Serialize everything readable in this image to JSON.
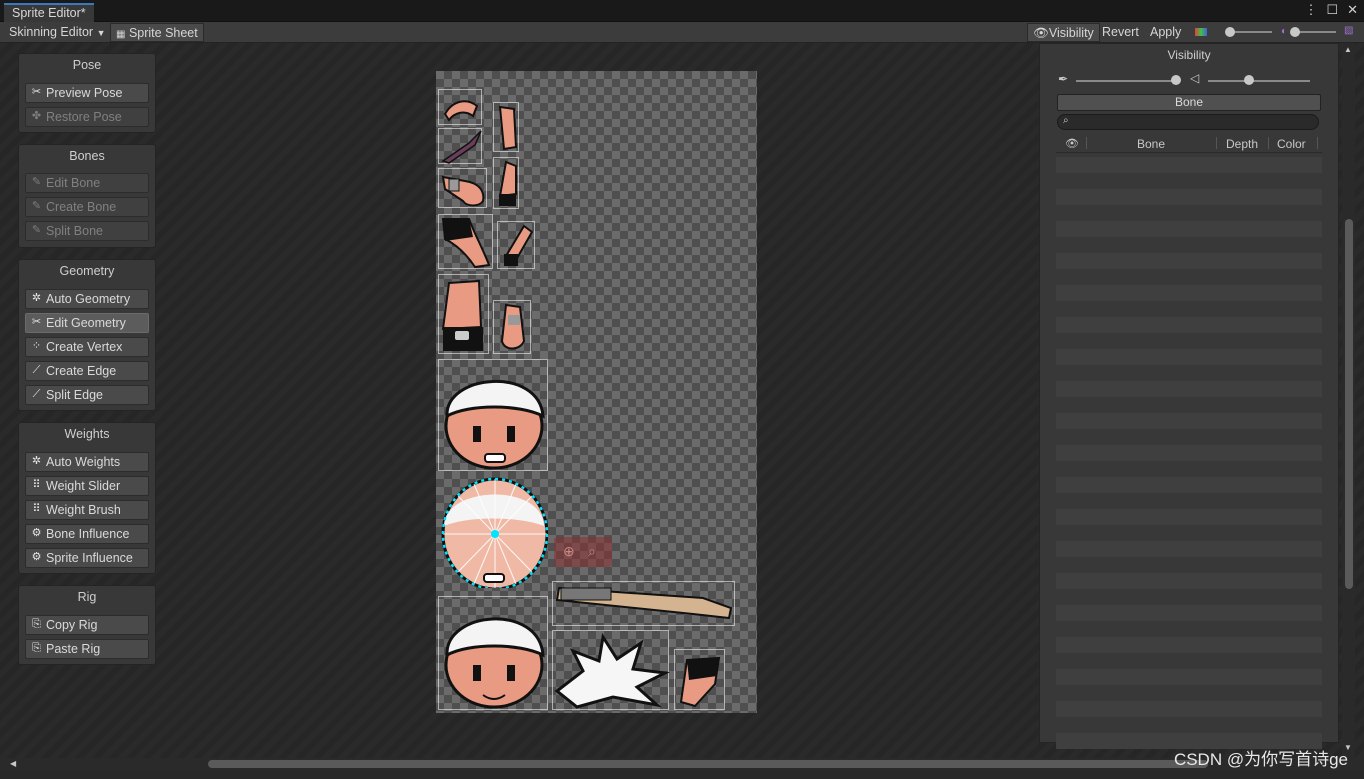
{
  "window": {
    "tab_title": "Sprite Editor*"
  },
  "toolbar": {
    "mode_dropdown": "Skinning Editor",
    "sprite_sheet": "Sprite Sheet",
    "visibility": "Visibility",
    "revert": "Revert",
    "apply": "Apply"
  },
  "pose": {
    "title": "Pose",
    "buttons": [
      "Preview Pose",
      "Restore Pose"
    ]
  },
  "bones": {
    "title": "Bones",
    "buttons": [
      "Edit Bone",
      "Create Bone",
      "Split Bone"
    ]
  },
  "geometry": {
    "title": "Geometry",
    "buttons": [
      "Auto Geometry",
      "Edit Geometry",
      "Create Vertex",
      "Create Edge",
      "Split Edge"
    ]
  },
  "weights": {
    "title": "Weights",
    "buttons": [
      "Auto Weights",
      "Weight Slider",
      "Weight Brush",
      "Bone Influence",
      "Sprite Influence"
    ]
  },
  "rig": {
    "title": "Rig",
    "buttons": [
      "Copy Rig",
      "Paste Rig"
    ]
  },
  "visibility_panel": {
    "title": "Visibility",
    "tab_label": "Bone",
    "columns": [
      "Bone",
      "Depth",
      "Color"
    ],
    "bone_opacity": 0.8,
    "mesh_opacity": 0.4
  },
  "watermark": "CSDN @为你写首诗ge"
}
